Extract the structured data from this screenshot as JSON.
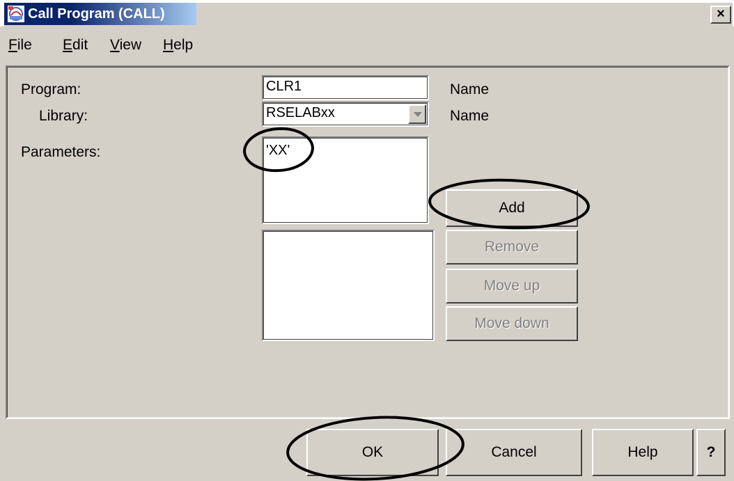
{
  "window": {
    "title": "Call Program (CALL)",
    "close_label": "✕"
  },
  "menu": {
    "file": {
      "ul": "F",
      "rest": "ile"
    },
    "edit": {
      "ul": "E",
      "rest": "dit"
    },
    "view": {
      "ul": "V",
      "rest": "iew"
    },
    "help": {
      "ul": "H",
      "rest": "elp"
    }
  },
  "form": {
    "program_label": "Program:",
    "program_value": "CLR1",
    "program_hint": "Name",
    "library_label": "Library:",
    "library_value": "RSELABxx",
    "library_hint": "Name",
    "parameters_label": "Parameters:",
    "parameter_input_value": "'XX'"
  },
  "param_buttons": {
    "add": "Add",
    "remove": "Remove",
    "move_up": "Move up",
    "move_down": "Move down"
  },
  "dialog_buttons": {
    "ok": "OK",
    "cancel": "Cancel",
    "help": "Help",
    "question": "?"
  },
  "colors": {
    "title_bar": "#0a246a",
    "face": "#d4d0c8",
    "annotation": "#000000"
  },
  "icons": {
    "app": "call-program-app-icon",
    "close": "close-icon",
    "dropdown": "chevron-down-icon"
  }
}
